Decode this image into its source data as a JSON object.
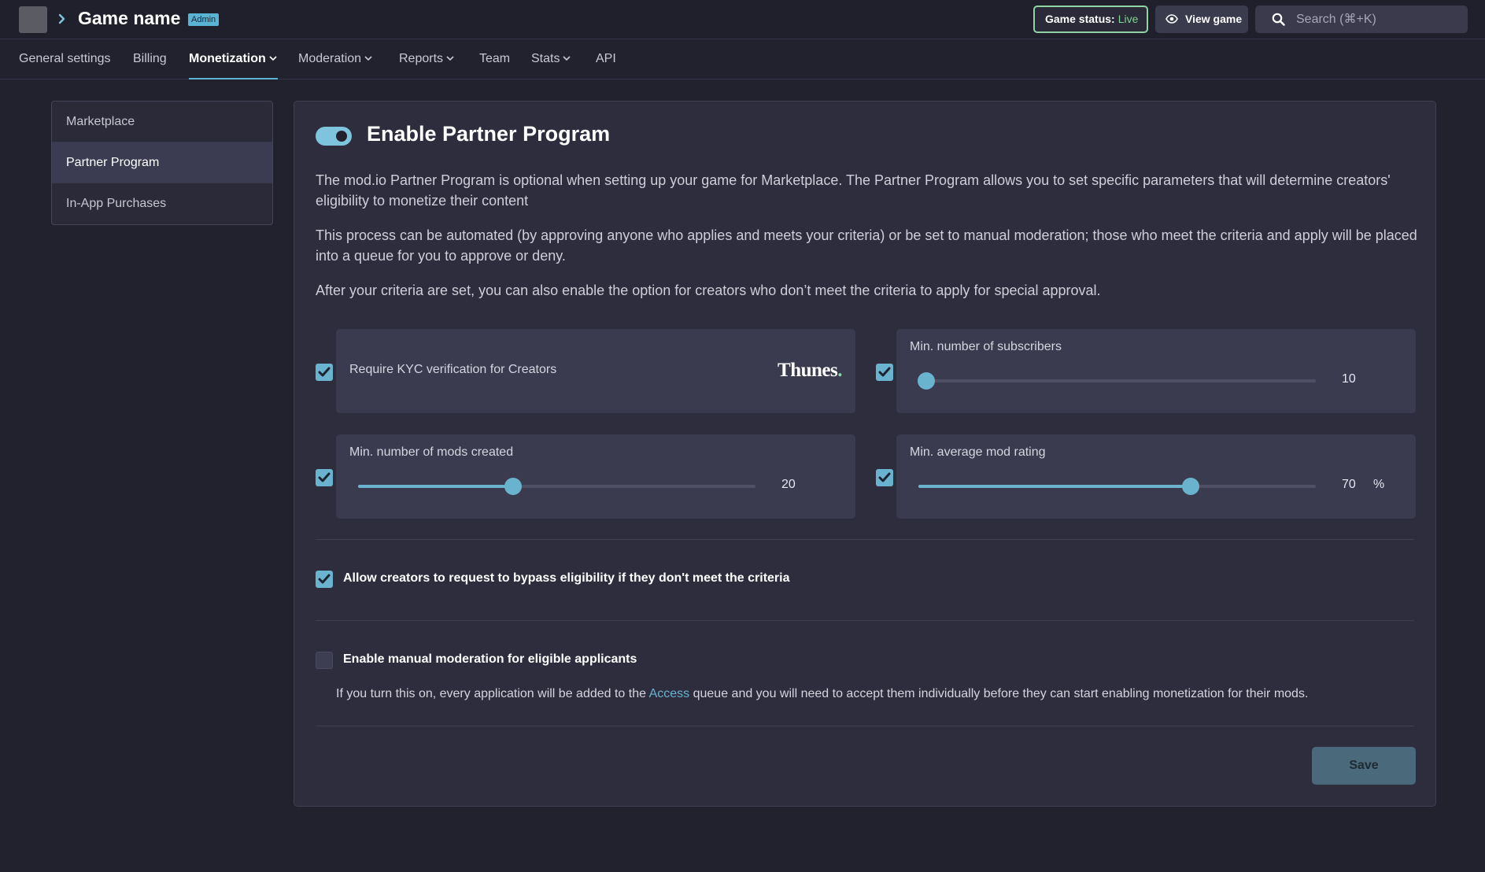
{
  "header": {
    "game_name": "Game name",
    "admin_badge": "Admin",
    "status_label": "Game status:",
    "status_value": "Live",
    "view_game_label": "View game",
    "search_placeholder": "Search (⌘+K)",
    "accent_color": "#5bb3d3",
    "live_color": "#7ed491"
  },
  "nav": {
    "tabs": [
      {
        "label": "General settings"
      },
      {
        "label": "Billing"
      },
      {
        "label": "Monetization",
        "active": true,
        "dropdown": true
      },
      {
        "label": "Moderation",
        "dropdown": true
      },
      {
        "label": "Reports",
        "dropdown": true
      },
      {
        "label": "Team"
      },
      {
        "label": "Stats",
        "dropdown": true
      },
      {
        "label": "API"
      }
    ]
  },
  "sidebar": {
    "items": [
      {
        "label": "Marketplace"
      },
      {
        "label": "Partner Program",
        "active": true
      },
      {
        "label": "In-App Purchases"
      }
    ]
  },
  "main": {
    "toggle_on": true,
    "title": "Enable Partner Program",
    "para1": "The mod.io Partner Program is optional when setting up your game for Marketplace. The Partner Program allows you to set specific parameters that will determine creators' eligibility to monetize their content",
    "para2": "This process can be automated (by approving anyone who applies and meets your criteria) or be set to manual moderation; those who meet the criteria and apply will be placed into a queue for you to approve or deny.",
    "para3": "After your criteria are set, you can also enable the option for creators who don’t meet the criteria to apply for special approval.",
    "kyc": {
      "label": "Require KYC verification for Creators",
      "checked": true,
      "brand": "Thunes",
      "brand_dot": "."
    },
    "subscribers": {
      "label": "Min. number of subscribers",
      "value": "10",
      "fraction": 0.02,
      "checked": true
    },
    "mods": {
      "label": "Min. number of mods created",
      "value": "20",
      "fraction": 0.39,
      "checked": true
    },
    "rating": {
      "label": "Min. average mod rating",
      "value": "70",
      "unit": "%",
      "fraction": 0.685,
      "checked": true
    },
    "bypass": {
      "label": "Allow creators to request to bypass eligibility if they don't meet the criteria",
      "checked": true
    },
    "manual": {
      "label": "Enable manual moderation for eligible applicants",
      "checked": false,
      "note_before": "If you turn this on, every application will be added to the ",
      "note_link": "Access",
      "note_after": " queue and you will need to accept them individually before they can start enabling monetization for their mods."
    },
    "save_label": "Save"
  }
}
